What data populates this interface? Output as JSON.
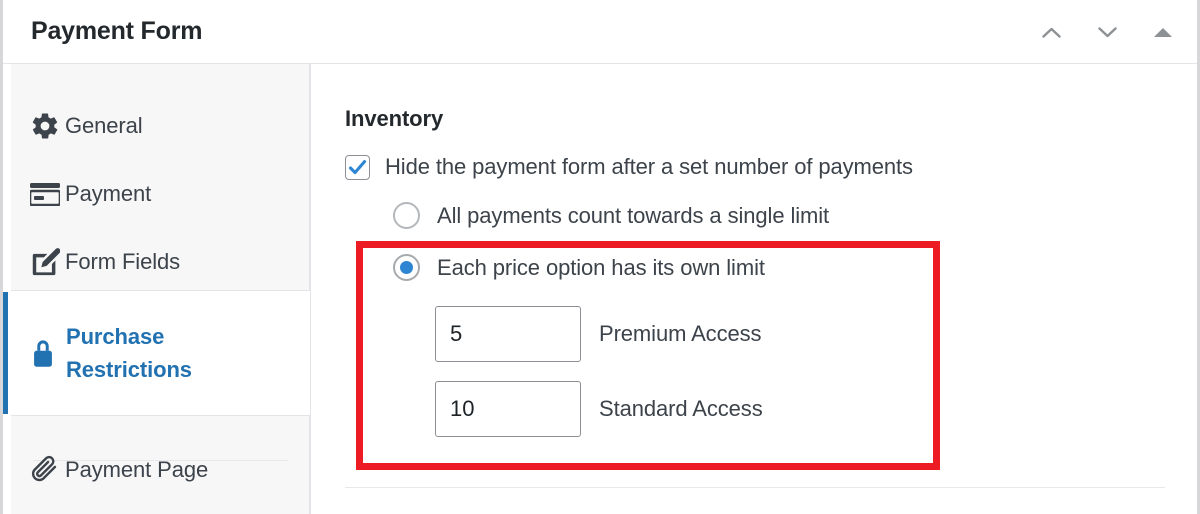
{
  "header": {
    "title": "Payment Form",
    "controls": [
      {
        "name": "move-up-button",
        "icon": "chevron-up-icon"
      },
      {
        "name": "move-down-button",
        "icon": "chevron-down-icon"
      },
      {
        "name": "collapse-button",
        "icon": "triangle-up-icon"
      }
    ]
  },
  "sidebar": {
    "items": [
      {
        "label": "General",
        "icon": "gear-icon",
        "active": false
      },
      {
        "label": "Payment",
        "icon": "credit-card-icon",
        "active": false
      },
      {
        "label": "Form Fields",
        "icon": "pencil-square-icon",
        "active": false
      },
      {
        "label_line1": "Purchase",
        "label_line2": "Restrictions",
        "icon": "lock-icon",
        "active": true
      },
      {
        "label": "Payment Page",
        "icon": "paperclip-icon",
        "active": false
      }
    ]
  },
  "content": {
    "section_title": "Inventory",
    "checkbox": {
      "label": "Hide the payment form after a set number of payments",
      "checked": true
    },
    "radios": [
      {
        "label": "All payments count towards a single limit",
        "selected": false
      },
      {
        "label": "Each price option has its own limit",
        "selected": true
      }
    ],
    "limits": [
      {
        "value": "5",
        "label": "Premium Access",
        "placeholder": ""
      },
      {
        "value": "10",
        "label": "Standard Access",
        "placeholder": ""
      }
    ]
  },
  "annotation": {
    "highlight_color": "#ed1c24"
  },
  "colors": {
    "accent_blue": "#2271b1",
    "check_blue": "#2e86d3",
    "text_dark": "#23282d",
    "text_body": "#3c434a",
    "panel_bg": "#f7f7f8",
    "border": "#e2e4e7"
  }
}
